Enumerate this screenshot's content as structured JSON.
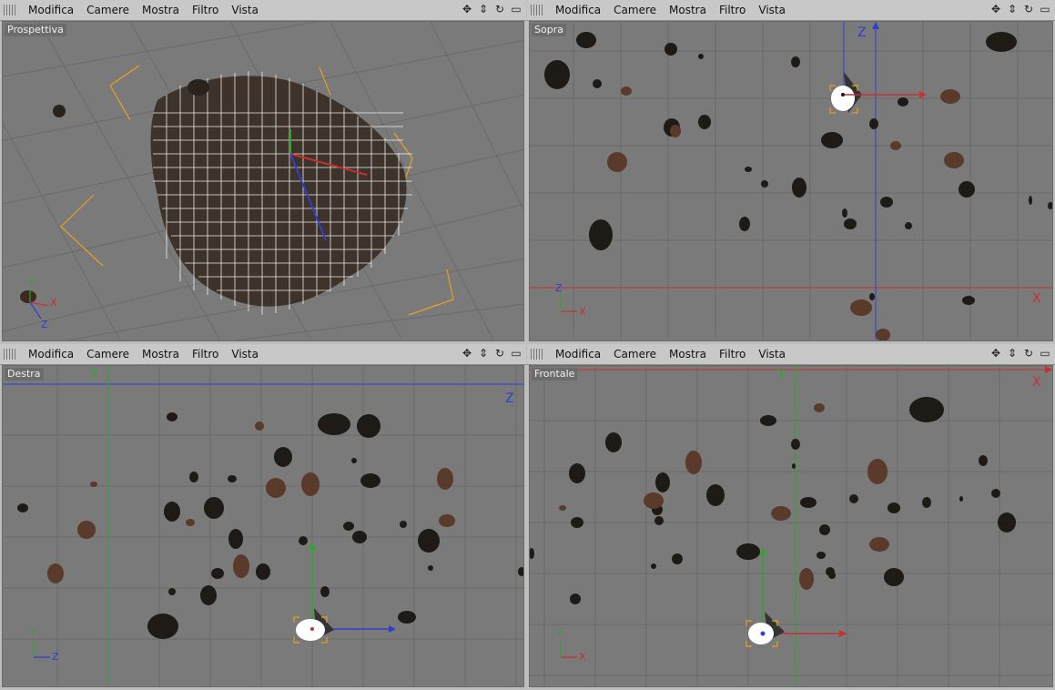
{
  "menu": [
    "Modifica",
    "Camere",
    "Mostra",
    "Filtro",
    "Vista"
  ],
  "nav_icons": [
    "move-icon",
    "zoom-icon",
    "rotate-icon",
    "maximize-icon"
  ],
  "viewports": {
    "top_left": {
      "label": "Prospettiva"
    },
    "top_right": {
      "label": "Sopra",
      "axis_h": "X",
      "axis_v": "Z"
    },
    "bottom_left": {
      "label": "Destra",
      "axis_h": "Z",
      "axis_v": "Y"
    },
    "bottom_right": {
      "label": "Frontale",
      "axis_h": "X",
      "axis_v": "Y"
    }
  },
  "mini_axes": {
    "top_left": [
      "Y",
      "X",
      "Z"
    ],
    "top_right": [
      "Z",
      "X"
    ],
    "bottom_left": [
      "Y",
      "Z"
    ],
    "bottom_right": [
      "Y",
      "X"
    ]
  },
  "colors": {
    "x_axis": "#c83030",
    "y_axis": "#2fa52f",
    "z_axis": "#2f3fd0",
    "rock_dark": "#1e1a16",
    "rock_brown": "#5a3a2a",
    "grid": "#6a6a6a",
    "selection": "#e8a020"
  }
}
